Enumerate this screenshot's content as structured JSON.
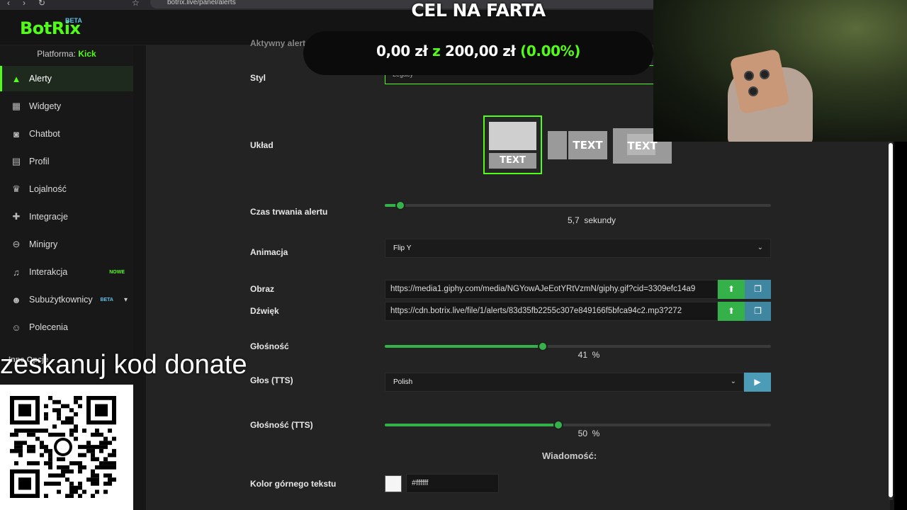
{
  "browser": {
    "url": "botrix.live/panel/alerts"
  },
  "app": {
    "logo": "BotRix",
    "logo_badge": "BETA"
  },
  "sidebar": {
    "platform_label": "Platforma:",
    "platform_value": "Kick",
    "items": [
      {
        "label": "Alerty",
        "icon": "warning-icon"
      },
      {
        "label": "Widgety",
        "icon": "grid-icon"
      },
      {
        "label": "Chatbot",
        "icon": "robot-icon"
      },
      {
        "label": "Profil",
        "icon": "id-card-icon"
      },
      {
        "label": "Lojalność",
        "icon": "trophy-icon"
      },
      {
        "label": "Integracje",
        "icon": "puzzle-icon"
      },
      {
        "label": "Minigry",
        "icon": "gamepad-icon"
      },
      {
        "label": "Interakcja",
        "icon": "music-icon",
        "badge": "NOWE"
      },
      {
        "label": "Subużytkownicy",
        "icon": "users-icon",
        "badge": "BETA"
      },
      {
        "label": "Polecenia",
        "icon": "user-plus-icon"
      }
    ],
    "section_partial": "Inne Opcje"
  },
  "form": {
    "active_label_partial": "Aktywny alert",
    "style_label": "Styl",
    "style_value": "Legacy",
    "layout_label": "Układ",
    "layout_text": "TEXT",
    "duration_label": "Czas trwania alertu",
    "duration_value": "5,7",
    "duration_unit": "sekundy",
    "duration_fraction": 0.04,
    "animation_label": "Animacja",
    "animation_value": "Flip Y",
    "image_label": "Obraz",
    "image_url": "https://media1.giphy.com/media/NGYowAJeEotYRtVzmN/giphy.gif?cid=3309efc14a9",
    "sound_label": "Dźwięk",
    "sound_url": "https://cdn.botrix.live/file/1/alerts/83d35fb2255c307e849166f5bfca94c2.mp3?272",
    "volume_label": "Głośność",
    "volume_value": "41",
    "volume_unit": "%",
    "volume_fraction": 0.41,
    "tts_voice_label": "Głos (TTS)",
    "tts_voice_value": "Polish",
    "tts_volume_label": "Głośność (TTS)",
    "tts_volume_value": "50",
    "tts_volume_unit": "%",
    "tts_volume_fraction": 0.45,
    "message_section": "Wiadomość:",
    "top_text_color_label": "Kolor górnego tekstu",
    "top_text_color_value": "#ffffff"
  },
  "overlay": {
    "goal_title": "CEL NA FARTA",
    "goal_current": "0,00 zł",
    "goal_sep": "z",
    "goal_target": "200,00 zł",
    "goal_percent": "(0.00%)",
    "donate_text": "zeskanuj kod donate"
  },
  "colors": {
    "accent": "#53fc18",
    "slider": "#35b14a",
    "upload": "#35b14a",
    "library": "#3f86a0",
    "beta": "#5ec1e8"
  }
}
